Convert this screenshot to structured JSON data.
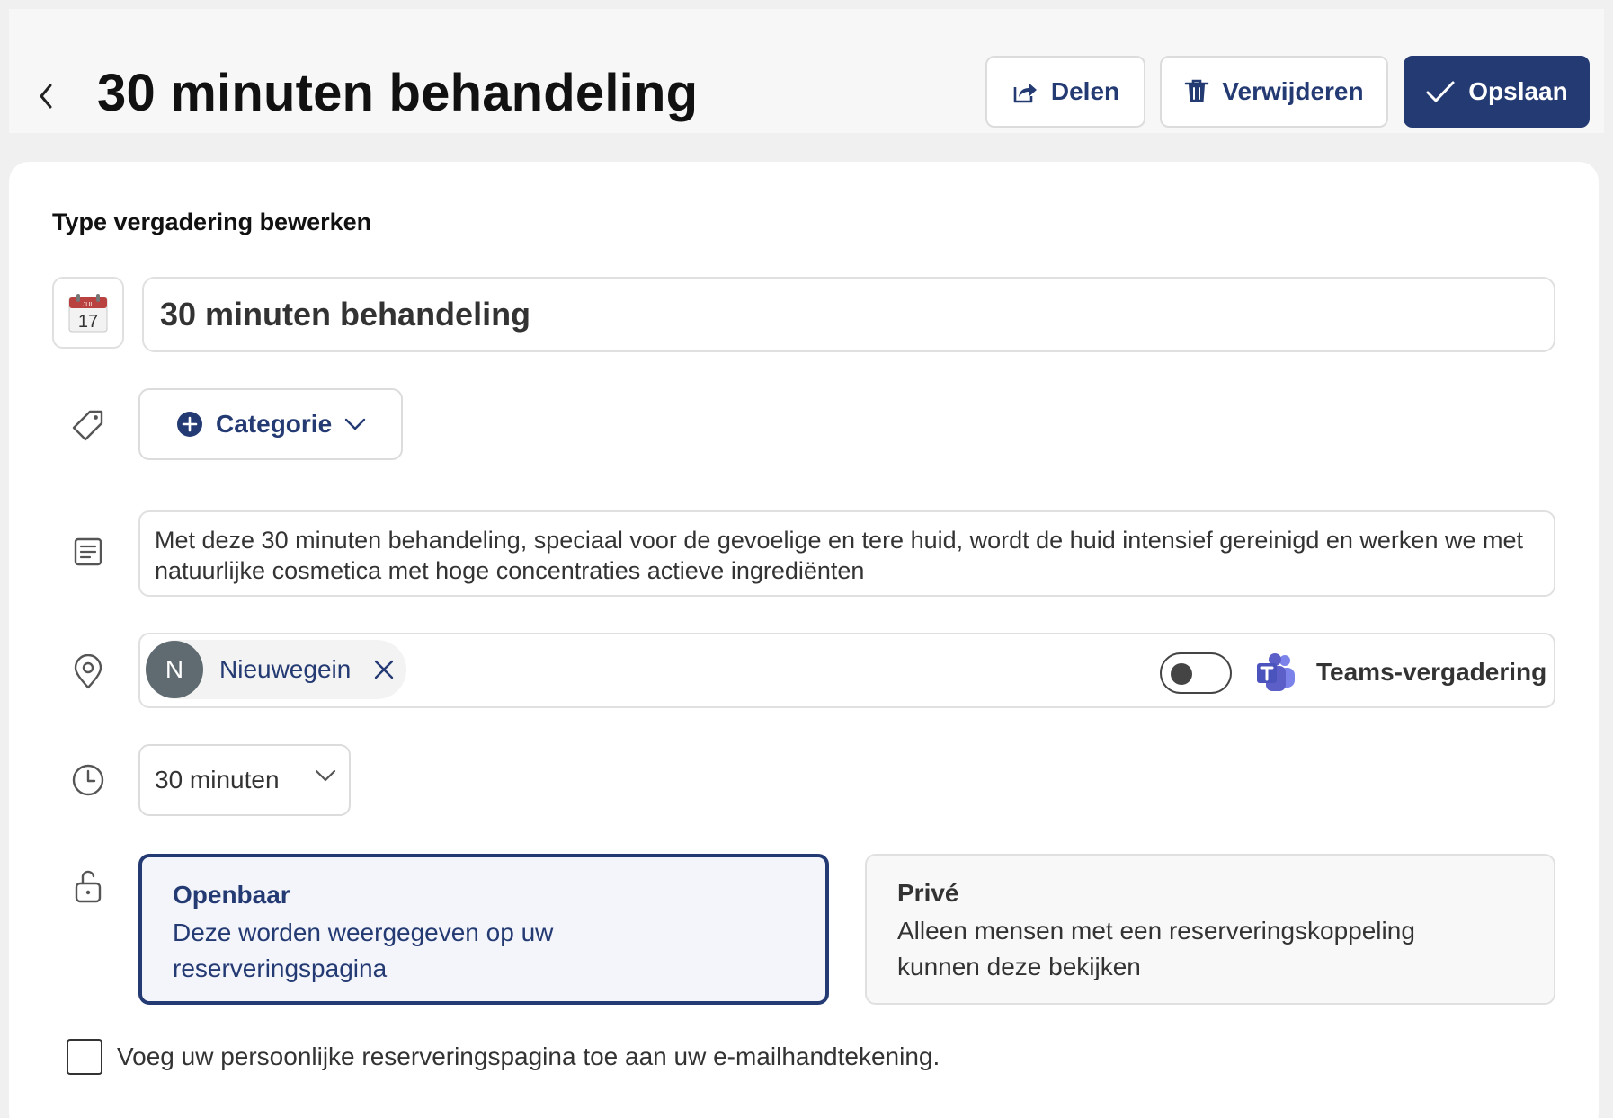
{
  "header": {
    "title": "30 minuten behandeling",
    "share_label": "Delen",
    "delete_label": "Verwijderen",
    "save_label": "Opslaan"
  },
  "form": {
    "section_title": "Type vergadering bewerken",
    "calendar_icon": {
      "month": "JUL",
      "day": "17"
    },
    "title_value": "30 minuten behandeling",
    "category_label": "Categorie",
    "description": "Met deze 30 minuten behandeling, speciaal voor de gevoelige en tere huid, wordt de huid intensief gereinigd en werken we met natuurlijke cosmetica met hoge concentraties actieve ingrediënten",
    "location": {
      "initial": "N",
      "name": "Nieuwegein",
      "teams_label": "Teams-vergadering",
      "teams_enabled": false
    },
    "duration": "30 minuten",
    "visibility": {
      "public": {
        "title": "Openbaar",
        "description": "Deze worden weergegeven op uw reserveringspagina",
        "selected": true
      },
      "private": {
        "title": "Privé",
        "description": "Alleen mensen met een reserveringskoppeling kunnen deze bekijken",
        "selected": false
      }
    },
    "signature_checkbox": {
      "label": "Voeg uw persoonlijke reserveringspagina toe aan uw e-mailhandtekening.",
      "checked": false
    }
  },
  "colors": {
    "accent": "#243a73",
    "teams_purple": "#5b5fc7",
    "avatar_bg": "#5f6b70"
  }
}
